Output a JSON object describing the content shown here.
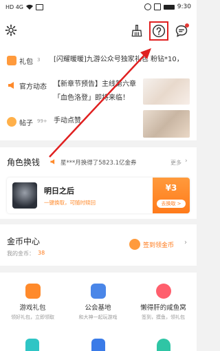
{
  "status_bar": {
    "signal": "HD 4G",
    "time": "9:30"
  },
  "feed": [
    {
      "category": "礼包",
      "badge": "3",
      "text": "[闪耀暖暖]九游公众号独家礼包 粉钻*10，"
    },
    {
      "category": "官方动态",
      "badge": "",
      "text_lines": [
        "【新章节预告】主线第六章",
        "「血色洛登」即将来临！"
      ]
    },
    {
      "category": "帖子",
      "badge": "99+",
      "text": "手动点赞"
    }
  ],
  "exchange": {
    "title": "角色换钱",
    "ticker": "星***月换得了5823.1亿金券",
    "more": "更多",
    "card": {
      "game_title": "明日之后",
      "subtitle": "一键换取，可随时赎回",
      "price": "¥3",
      "action": "去换取 >"
    }
  },
  "coins": {
    "title": "金币中心",
    "my_coins_label": "我的金币：",
    "my_coins_value": "38",
    "sign_in": "签到领金币"
  },
  "grid": [
    {
      "title": "游戏礼包",
      "sub": "领好礼包，立即领取"
    },
    {
      "title": "公会基地",
      "sub": "和大神一起玩游戏"
    },
    {
      "title": "懒得肝的咸鱼窝",
      "sub": "签到，摸鱼，领礼包"
    }
  ],
  "colors": {
    "accent": "#ff7a1a",
    "annotation": "#e02020",
    "link": "#2a6dc8"
  }
}
